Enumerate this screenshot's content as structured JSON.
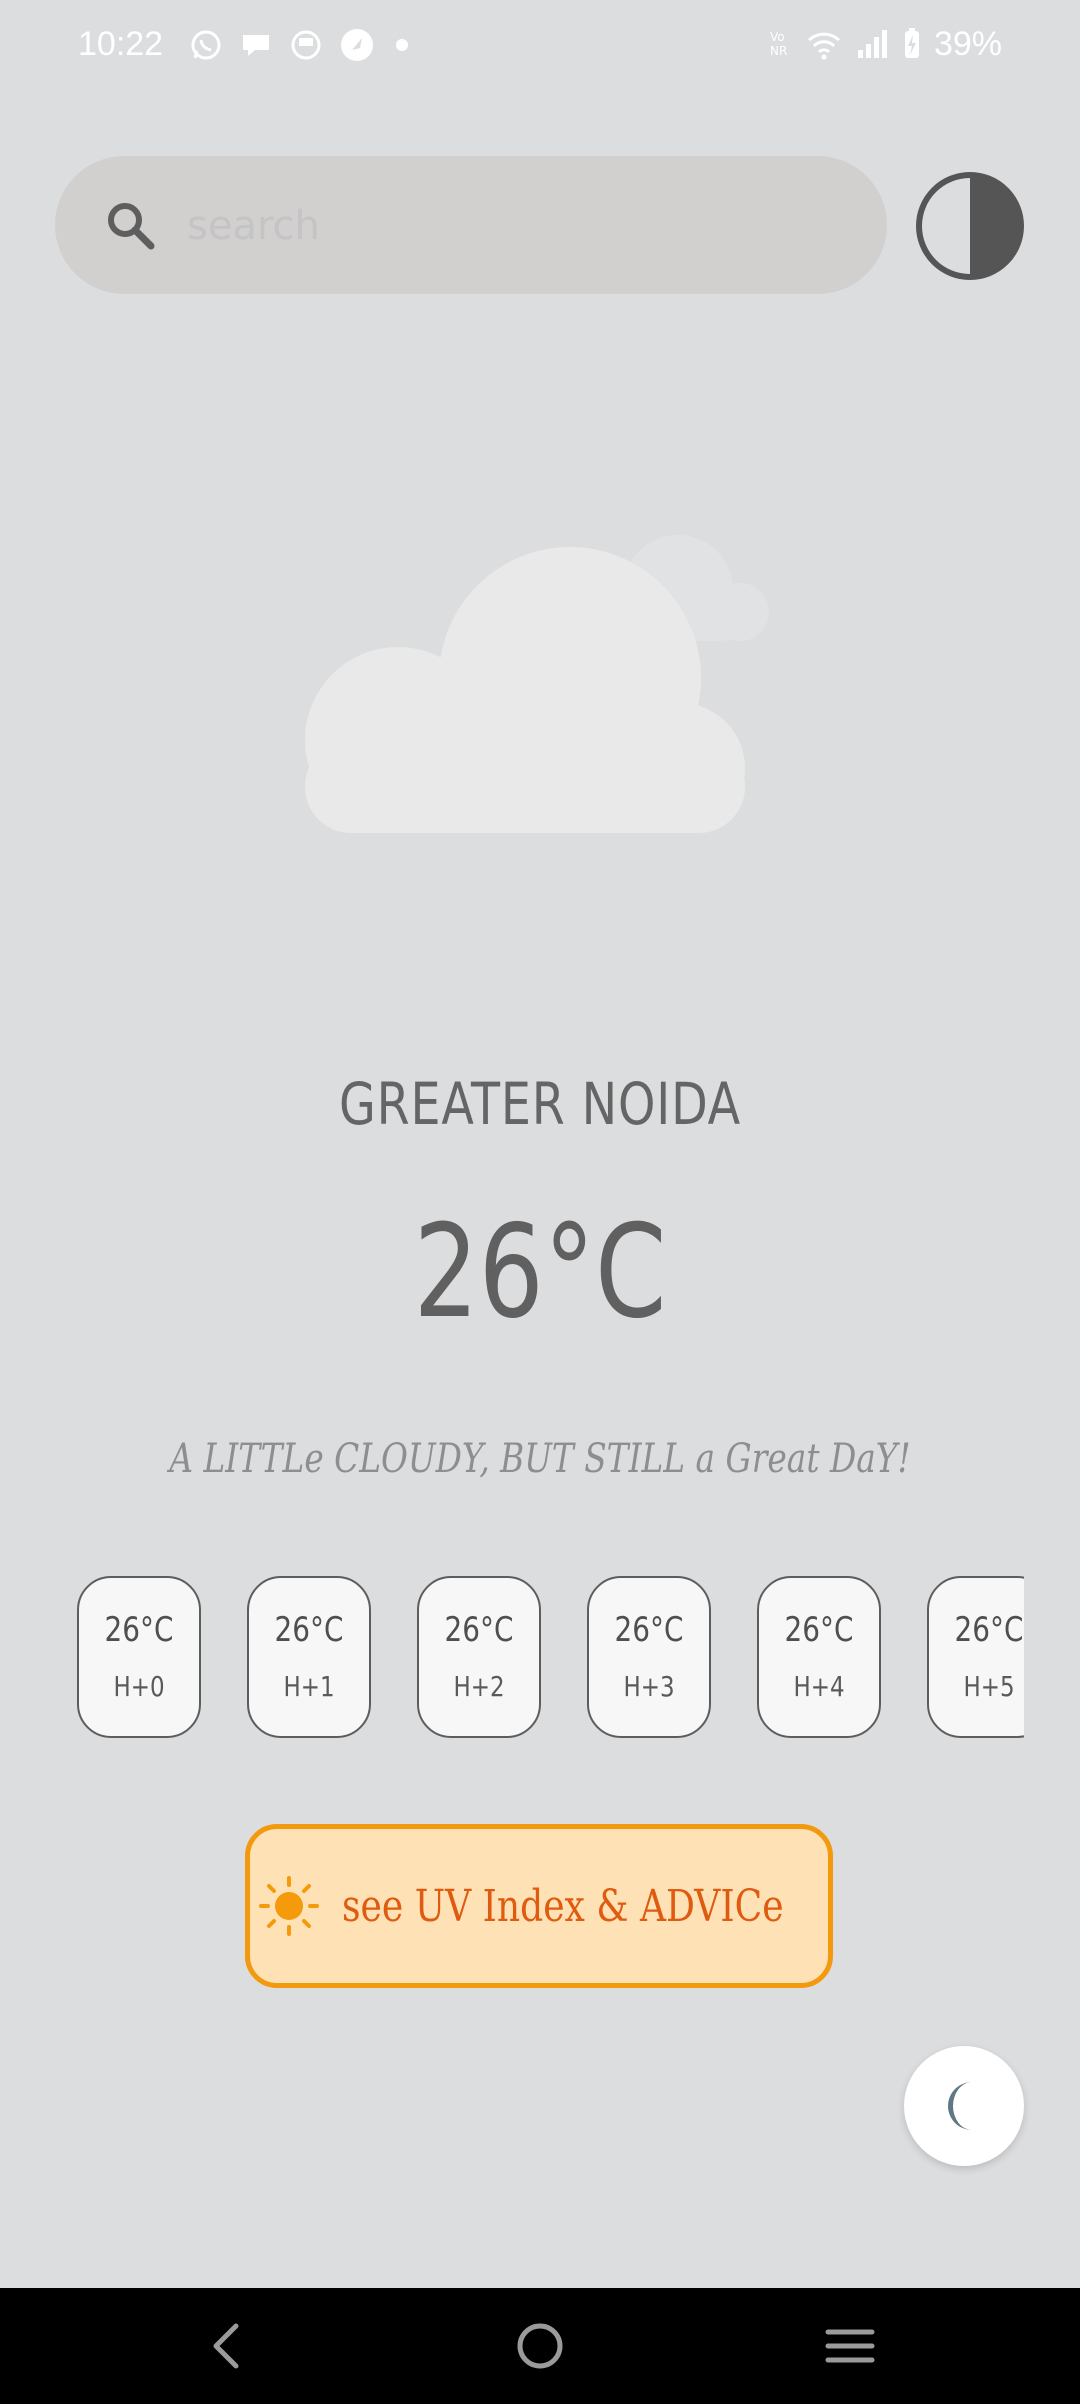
{
  "status_bar": {
    "time": "10:22",
    "battery": "39%",
    "left_icons": [
      "whatsapp-icon",
      "chat-bubble-icon",
      "app-icon",
      "compass-icon",
      "dot-icon"
    ],
    "right_icons": [
      "volte-icon",
      "wifi-icon",
      "signal-icon",
      "battery-charging-icon"
    ]
  },
  "search": {
    "placeholder": "search",
    "value": ""
  },
  "weather": {
    "city": "GREATER NOIDA",
    "temperature": "26°C",
    "description": "A LITTLe CLOUDY, BUT STILL a Great DaY!",
    "icon": "cloud-icon"
  },
  "hourly": [
    {
      "temp": "26°C",
      "label": "H+0"
    },
    {
      "temp": "26°C",
      "label": "H+1"
    },
    {
      "temp": "26°C",
      "label": "H+2"
    },
    {
      "temp": "26°C",
      "label": "H+3"
    },
    {
      "temp": "26°C",
      "label": "H+4"
    },
    {
      "temp": "26°C",
      "label": "H+5"
    }
  ],
  "uv_button": {
    "label": "see UV Index & ADVICe",
    "icon": "sun-icon"
  },
  "colors": {
    "background": "#dcdddf",
    "accent_orange": "#f2990d",
    "uv_text": "#de5b10",
    "uv_background": "#ffe1b6",
    "text_dark": "#606060"
  }
}
